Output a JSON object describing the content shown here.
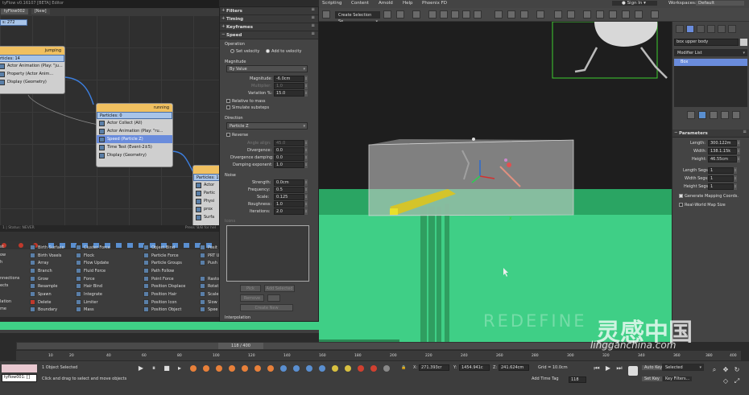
{
  "flow_window": {
    "title": "tyFlow v0.16107 [BETA] Editor",
    "tabs": [
      "tyFlow002",
      "[New]"
    ],
    "count_box": "s: 272",
    "status_left": "1 | Status: NEVER",
    "status_right": "Press 'B/B for hel",
    "event_jumping": {
      "name": "jumping",
      "particles": "rticles: 14",
      "ops": [
        "Actor Animation (Play: \"ju...",
        "Property (Actor Anim...",
        "Display (Geometry)"
      ]
    },
    "event_running": {
      "name": "running",
      "particles": "Particles: 0",
      "ops": [
        "Actor Collect (All)",
        "Actor Animation (Play: \"ru...",
        "Speed (Particle Z)",
        "Time Test (Event-2±5)",
        "Display (Geometry)"
      ]
    },
    "event_third": {
      "particles": "Particles: 1",
      "ops": [
        "Actor",
        "Partic",
        "Physi",
        "prox",
        "Surfa"
      ]
    }
  },
  "depot": {
    "col0": [
      "st",
      "ow",
      "h",
      "nnections",
      "ects",
      "",
      "lation",
      "me"
    ],
    "col1": [
      "Birth Surface",
      "Birth Voxels",
      "Array",
      "Branch",
      "Grow",
      "Resample",
      "Spawn",
      "Delete",
      "Boundary"
    ],
    "col2": [
      "Cluster Force",
      "Flock",
      "Flow Update",
      "Fluid Force",
      "Force",
      "Hair Bind",
      "Integrate",
      "Limiter",
      "Mass"
    ],
    "col3": [
      "Object Bind",
      "Particle Force",
      "Particle Groups",
      "Path Follow",
      "Point Force",
      "Position Displace",
      "Position Hair",
      "Position Icon",
      "Position Object"
    ],
    "col4": [
      "Posit",
      "PRT U",
      "Push",
      "Rasto",
      "Rotat",
      "Scale",
      "Slow",
      "Spee"
    ]
  },
  "params": {
    "rollouts_top": [
      "Filters",
      "Timing",
      "Keyframes",
      "Speed"
    ],
    "operation_label": "Operation",
    "set_velocity": "Set velocity",
    "add_velocity": "Add to velocity",
    "magnitude_label": "Magnitude",
    "magnitude_type": "By Value",
    "magnitude": {
      "label": "Magnitude:",
      "value": "-6.0cm"
    },
    "multiplier": {
      "label": "Multiplier:",
      "value": "1.0"
    },
    "variation": {
      "label": "Variation %:",
      "value": "15.0"
    },
    "relative_to_mass": "Relative to mass",
    "simulate_substeps": "Simulate substeps",
    "direction_label": "Direction",
    "direction_type": "Particle Z",
    "reverse": "Reverse",
    "angle_align": {
      "label": "Angle align:",
      "value": "45.0"
    },
    "divergence": {
      "label": "Divergence:",
      "value": "0.0"
    },
    "divergence_damping": {
      "label": "Divergence damping:",
      "value": "0.0"
    },
    "damping_exponent": {
      "label": "Damping exponent:",
      "value": "1.0"
    },
    "noise_label": "Noise",
    "strength": {
      "label": "Strength:",
      "value": "0.0cm"
    },
    "frequency": {
      "label": "Frequency:",
      "value": "0.5"
    },
    "scale": {
      "label": "Scale:",
      "value": "0.125"
    },
    "roughness": {
      "label": "Roughness:",
      "value": "1.0"
    },
    "iterations": {
      "label": "Iterations:",
      "value": "2.0"
    },
    "icons_label": "Icons",
    "btn_pick": "Pick",
    "btn_add_selected": "Add Selected",
    "btn_remove": "Remove",
    "btn_create_new": "Create New",
    "interpolation": "Interpolation"
  },
  "max": {
    "menus": [
      "Scripting",
      "Content",
      "Arnold",
      "Help",
      "Phoenix FD"
    ],
    "sign_in": "Sign In",
    "workspaces_label": "Workspaces:",
    "workspace": "Default",
    "selection_set": "Create Selection Se"
  },
  "command_panel": {
    "object_name": "box upper body",
    "modifier_list": "Modifier List",
    "stack_item": "Box",
    "parameters_title": "Parameters",
    "length": {
      "label": "Length:",
      "value": "300.122m"
    },
    "width": {
      "label": "Width:",
      "value": "138.1.15k"
    },
    "height": {
      "label": "Height:",
      "value": "46.55cm"
    },
    "length_segs": {
      "label": "Length Segs:",
      "value": "1"
    },
    "width_segs": {
      "label": "Width Segs:",
      "value": "1"
    },
    "height_segs": {
      "label": "Height Segs:",
      "value": "1"
    },
    "gen_mapping": "Generate Mapping Coords.",
    "real_world": "Real-World Map Size"
  },
  "timeline": {
    "frame": "118 / 400",
    "ticks": [
      "10",
      "20",
      "40",
      "60",
      "80",
      "100",
      "120",
      "140",
      "160",
      "180",
      "200",
      "220",
      "240",
      "260",
      "280",
      "300",
      "320",
      "340",
      "360",
      "380",
      "400"
    ]
  },
  "status": {
    "listener": "tyflow001: []",
    "selected": "1 Object Selected",
    "prompt": "Click and drag to select and move objects",
    "x": "271.393cr",
    "y": "1454.941c",
    "z": "241.624cm",
    "grid": "Grid = 10.0cm",
    "add_time_tag": "Add Time Tag",
    "frame_field": "118",
    "auto_key": "Auto Key",
    "selected_dd": "Selected",
    "set_key": "Set Key",
    "key_filters": "Key Filters..."
  },
  "watermark": {
    "text": "REDEFINE",
    "brand_cn": "灵感中国",
    "site": "lingganchina.com"
  },
  "colors": {
    "ground": "#3fcf86",
    "flow_header": "#f0c060",
    "particle_list": "#a8c4e8",
    "selected_op": "#6a8cdc"
  }
}
